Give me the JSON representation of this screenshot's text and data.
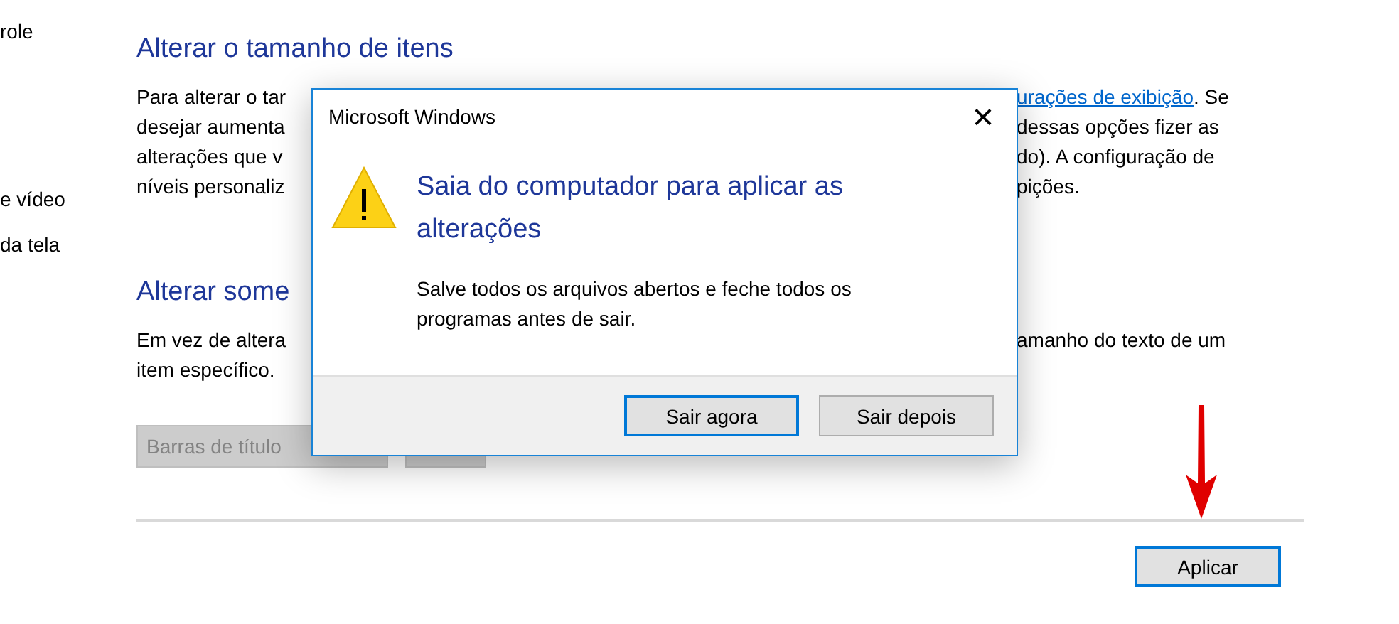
{
  "sidebar": {
    "items": [
      {
        "label": "role"
      },
      {
        "label": "e vídeo"
      },
      {
        "label": "da tela"
      }
    ]
  },
  "sections": [
    {
      "heading": "Alterar o tamanho de itens",
      "lines": [
        {
          "left": "Para alterar o tar",
          "link": "urações de exibição",
          "right": ". Se"
        },
        {
          "left": "desejar aumenta",
          "right": "dessas opções fizer as"
        },
        {
          "left": "alterações que v",
          "right": "do). A configuração de"
        },
        {
          "left": "níveis personaliz",
          "right": "pições."
        }
      ]
    },
    {
      "heading": "Alterar some",
      "lines": [
        {
          "left": "Em vez de altera",
          "right": "amanho do texto de um"
        },
        {
          "left": "item específico."
        }
      ],
      "dropdowns": [
        {
          "value": "Barras de título",
          "disabled": true
        },
        {
          "disabled": true
        }
      ]
    }
  ],
  "apply_button": {
    "label": "Aplicar",
    "default": true
  },
  "dialog": {
    "title": "Microsoft Windows",
    "close": "×",
    "heading": "Saia do computador para aplicar as alterações",
    "message": "Salve todos os arquivos abertos e feche todos os programas antes de sair.",
    "buttons": [
      {
        "label": "Sair agora",
        "default": true
      },
      {
        "label": "Sair depois",
        "default": false
      }
    ]
  }
}
